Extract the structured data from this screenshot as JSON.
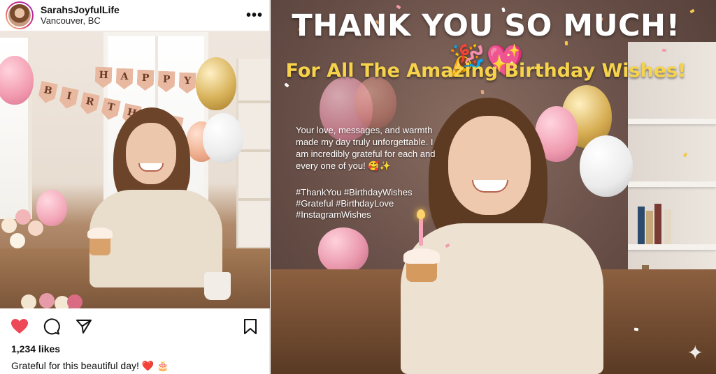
{
  "post": {
    "username": "SarahsJoyfulLife",
    "location": "Vancouver, BC",
    "more_label": "•••",
    "banner_letters": [
      "H",
      "A",
      "P",
      "P",
      "Y"
    ],
    "banner_letters2": [
      "B",
      "I",
      "R",
      "T",
      "H",
      "D",
      "A"
    ],
    "likes": "1,234 likes",
    "caption": "Grateful for this beautiful day! ❤️ 🎂",
    "icons": {
      "like": "heart-icon",
      "comment": "comment-bubble-icon",
      "share": "send-icon",
      "save": "bookmark-icon"
    },
    "colors": {
      "heart": "#ed4956"
    }
  },
  "feature": {
    "headline": "THANK YOU SO MUCH! 🎉💖",
    "subhead": "For All The Amazing Birthday Wishes!",
    "message": "Your love, messages, and warmth made my day truly unforgettable. I am incredibly grateful for each and every one of you! 🥰✨",
    "hashtags": [
      "#ThankYou #BirthdayWishes",
      "#Grateful #BirthdayLove",
      "#InstagramWishes"
    ],
    "colors": {
      "subhead": "#f6d34a",
      "headline": "#ffffff"
    }
  }
}
